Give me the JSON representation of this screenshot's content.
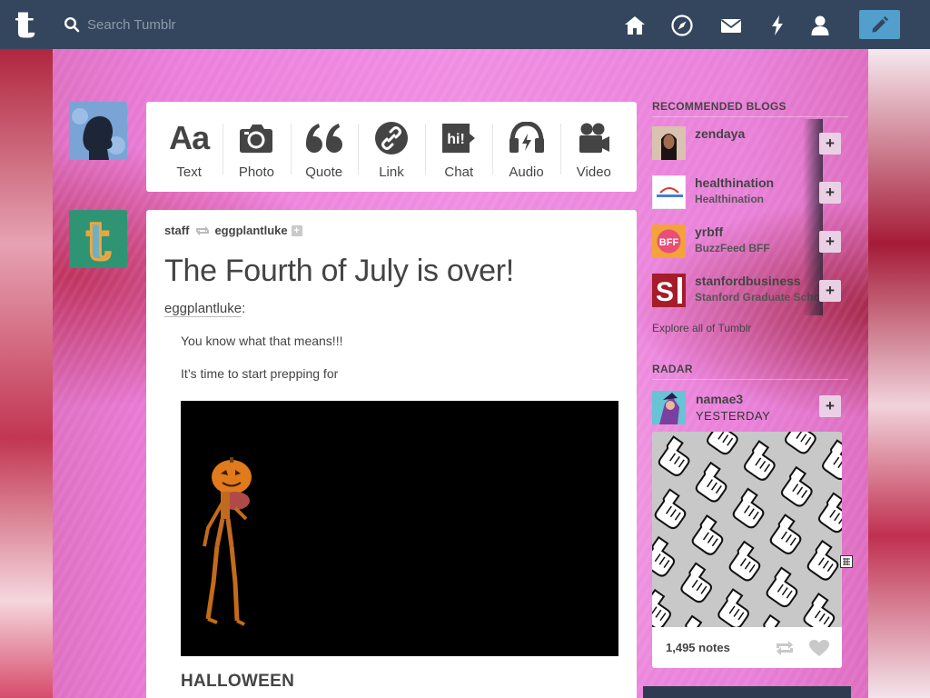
{
  "header": {
    "search_placeholder": "Search Tumblr",
    "nav_icons": [
      "home-icon",
      "explore-icon",
      "inbox-icon",
      "activity-icon",
      "account-icon"
    ],
    "compose_icon": "pencil-icon"
  },
  "post_types": [
    {
      "label": "Text",
      "icon": "text-icon"
    },
    {
      "label": "Photo",
      "icon": "camera-icon"
    },
    {
      "label": "Quote",
      "icon": "quote-icon"
    },
    {
      "label": "Link",
      "icon": "link-icon"
    },
    {
      "label": "Chat",
      "icon": "chat-icon"
    },
    {
      "label": "Audio",
      "icon": "headphones-icon"
    },
    {
      "label": "Video",
      "icon": "video-camera-icon"
    }
  ],
  "post": {
    "reblogger": "staff",
    "source": "eggplantluke",
    "title": "The Fourth of July is over!",
    "author": "eggplantluke",
    "author_suffix": ":",
    "lines": [
      "You know what that means!!!",
      "It’s time to start prepping for"
    ],
    "heading": "HALLOWEEN"
  },
  "recommended": {
    "title": "RECOMMENDED BLOGS",
    "blogs": [
      {
        "name": "zendaya",
        "title": ""
      },
      {
        "name": "healthination",
        "title": "Healthination"
      },
      {
        "name": "yrbff",
        "title": "BuzzFeed BFF"
      },
      {
        "name": "stanfordbusiness",
        "title": "Stanford Graduate School"
      }
    ],
    "explore": "Explore all of Tumblr"
  },
  "radar": {
    "title": "RADAR",
    "blog": "namae3",
    "when": "YESTERDAY",
    "notes": "1,495 notes"
  },
  "colors": {
    "header_bg": "#34465d",
    "compose_bg": "#529ecc",
    "text": "#444444"
  }
}
